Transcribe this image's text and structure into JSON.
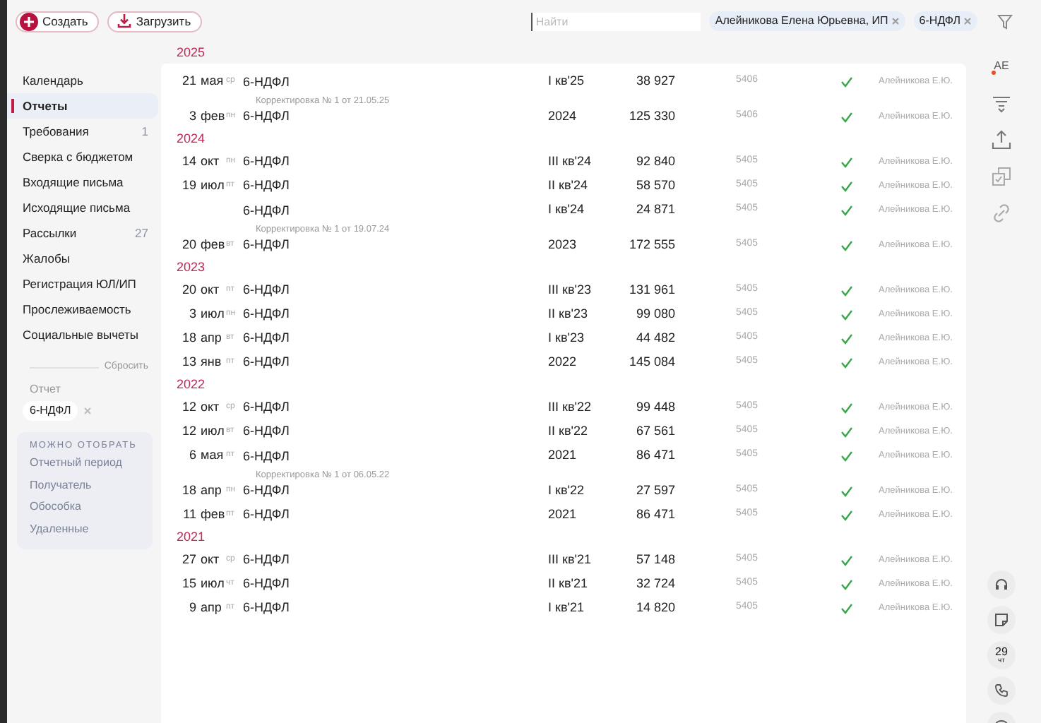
{
  "toolbar": {
    "create_button": "Создать",
    "upload_button": "Загрузить",
    "search": {
      "placeholder": "Найти"
    },
    "filter_chips": [
      "Алейникова Елена Юрьевна, ИП",
      "6-НДФЛ"
    ]
  },
  "sidebar": {
    "items": [
      {
        "label": "Календарь",
        "selected": false
      },
      {
        "label": "Отчеты",
        "selected": true
      },
      {
        "label": "Требования",
        "selected": false,
        "count": "1"
      },
      {
        "label": "Сверка с бюджетом",
        "selected": false
      },
      {
        "label": "Входящие письма",
        "selected": false
      },
      {
        "label": "Исходящие письма",
        "selected": false
      },
      {
        "label": "Рассылки",
        "selected": false,
        "count": "27"
      },
      {
        "label": "Жалобы",
        "selected": false
      },
      {
        "label": "Регистрация ЮЛ/ИП",
        "selected": false
      },
      {
        "label": "Прослеживаемость",
        "selected": false
      },
      {
        "label": "Социальные вычеты",
        "selected": false
      }
    ],
    "reset": "Сбросить",
    "active_filter": {
      "label": "Отчет",
      "value": "6-НДФЛ"
    },
    "available_filters": {
      "title": "МОЖНО ОТОБРАТЬ",
      "items": [
        "Отчетный период",
        "Получатель",
        "Обособка",
        "Удаленные"
      ]
    }
  },
  "groups": [
    {
      "year": "2025",
      "rows": [
        {
          "day": "21",
          "month": "мая",
          "weekday": "ср",
          "title": "6-НДФЛ",
          "note": "Корректировка № 1 от 21.05.25",
          "period": "I кв'25",
          "amount": "38 927",
          "code": "5406",
          "signed": true,
          "signer": "Алейникова Е.Ю."
        },
        {
          "day": "3",
          "month": "фев",
          "weekday": "пн",
          "title": "6-НДФЛ",
          "period": "2024",
          "amount": "125 330",
          "code": "5406",
          "signed": true,
          "signer": "Алейникова Е.Ю."
        }
      ]
    },
    {
      "year": "2024",
      "rows": [
        {
          "day": "14",
          "month": "окт",
          "weekday": "пн",
          "title": "6-НДФЛ",
          "period": "III кв'24",
          "amount": "92 840",
          "code": "5405",
          "signed": true,
          "signer": "Алейникова Е.Ю."
        },
        {
          "day": "19",
          "month": "июл",
          "weekday": "пт",
          "title": "6-НДФЛ",
          "period": "II кв'24",
          "amount": "58 570",
          "code": "5405",
          "signed": true,
          "signer": "Алейникова Е.Ю."
        },
        {
          "title": "6-НДФЛ",
          "note": "Корректировка № 1 от 19.07.24",
          "period": "I кв'24",
          "amount": "24 871",
          "code": "5405",
          "signed": true,
          "signer": "Алейникова Е.Ю."
        },
        {
          "day": "20",
          "month": "фев",
          "weekday": "вт",
          "title": "6-НДФЛ",
          "period": "2023",
          "amount": "172 555",
          "code": "5405",
          "signed": true,
          "signer": "Алейникова Е.Ю."
        }
      ]
    },
    {
      "year": "2023",
      "rows": [
        {
          "day": "20",
          "month": "окт",
          "weekday": "пт",
          "title": "6-НДФЛ",
          "period": "III кв'23",
          "amount": "131 961",
          "code": "5405",
          "signed": true,
          "signer": "Алейникова Е.Ю."
        },
        {
          "day": "3",
          "month": "июл",
          "weekday": "пн",
          "title": "6-НДФЛ",
          "period": "II кв'23",
          "amount": "99 080",
          "code": "5405",
          "signed": true,
          "signer": "Алейникова Е.Ю."
        },
        {
          "day": "18",
          "month": "апр",
          "weekday": "вт",
          "title": "6-НДФЛ",
          "period": "I кв'23",
          "amount": "44 482",
          "code": "5405",
          "signed": true,
          "signer": "Алейникова Е.Ю."
        },
        {
          "day": "13",
          "month": "янв",
          "weekday": "пт",
          "title": "6-НДФЛ",
          "period": "2022",
          "amount": "145 084",
          "code": "5405",
          "signed": true,
          "signer": "Алейникова Е.Ю."
        }
      ]
    },
    {
      "year": "2022",
      "rows": [
        {
          "day": "12",
          "month": "окт",
          "weekday": "ср",
          "title": "6-НДФЛ",
          "period": "III кв'22",
          "amount": "99 448",
          "code": "5405",
          "signed": true,
          "signer": "Алейникова Е.Ю."
        },
        {
          "day": "12",
          "month": "июл",
          "weekday": "вт",
          "title": "6-НДФЛ",
          "period": "II кв'22",
          "amount": "67 561",
          "code": "5405",
          "signed": true,
          "signer": "Алейникова Е.Ю."
        },
        {
          "day": "6",
          "month": "мая",
          "weekday": "пт",
          "title": "6-НДФЛ",
          "note": "Корректировка № 1 от 06.05.22",
          "period": "2021",
          "amount": "86 471",
          "code": "5405",
          "signed": true,
          "signer": "Алейникова Е.Ю."
        },
        {
          "day": "18",
          "month": "апр",
          "weekday": "пн",
          "title": "6-НДФЛ",
          "period": "I кв'22",
          "amount": "27 597",
          "code": "5405",
          "signed": true,
          "signer": "Алейникова Е.Ю."
        },
        {
          "day": "11",
          "month": "фев",
          "weekday": "пт",
          "title": "6-НДФЛ",
          "period": "2021",
          "amount": "86 471",
          "code": "5405",
          "signed": true,
          "signer": "Алейникова Е.Ю."
        }
      ]
    },
    {
      "year": "2021",
      "rows": [
        {
          "day": "27",
          "month": "окт",
          "weekday": "ср",
          "title": "6-НДФЛ",
          "period": "III кв'21",
          "amount": "57 148",
          "code": "5405",
          "signed": true,
          "signer": "Алейникова Е.Ю."
        },
        {
          "day": "15",
          "month": "июл",
          "weekday": "чт",
          "title": "6-НДФЛ",
          "period": "II кв'21",
          "amount": "32 724",
          "code": "5405",
          "signed": true,
          "signer": "Алейникова Е.Ю."
        },
        {
          "day": "9",
          "month": "апр",
          "weekday": "пт",
          "title": "6-НДФЛ",
          "period": "I кв'21",
          "amount": "14 820",
          "code": "5405",
          "signed": true,
          "signer": "Алейникова Е.Ю."
        }
      ]
    }
  ],
  "rail": {
    "avatar": "АЕ",
    "calendar": {
      "day": "29",
      "weekday": "чт"
    }
  }
}
